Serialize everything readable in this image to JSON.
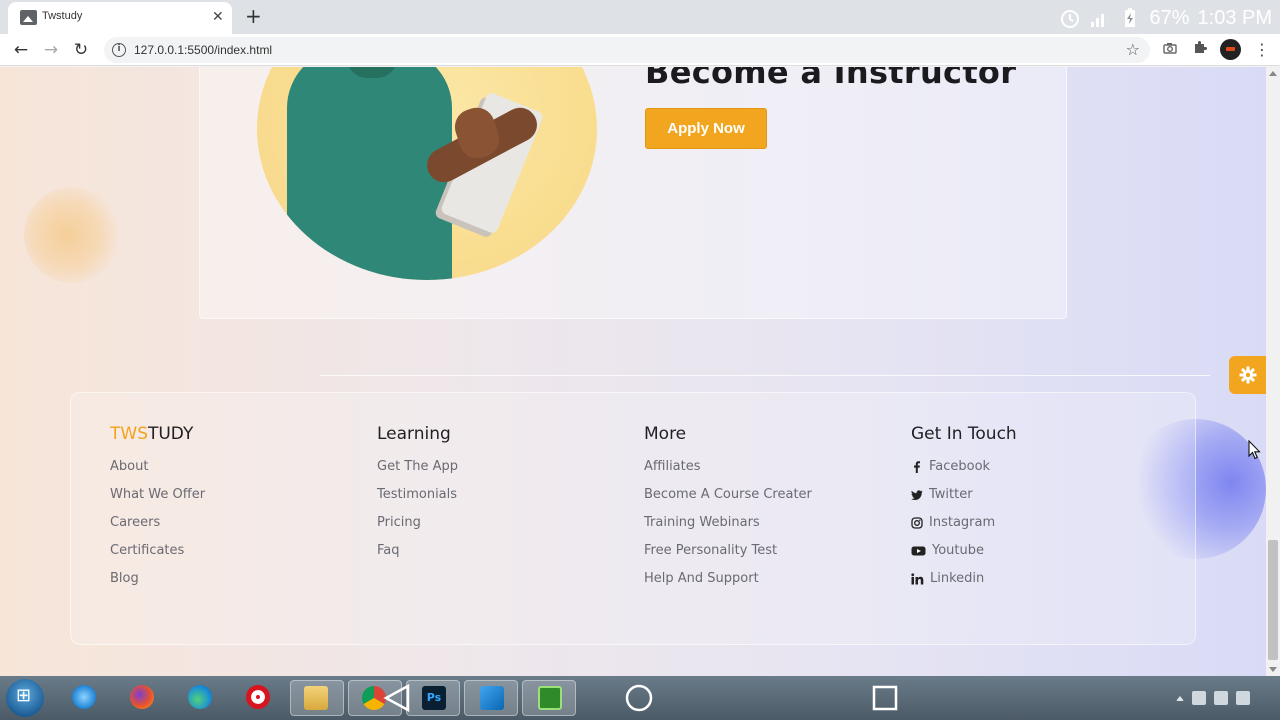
{
  "browser": {
    "tab_title": "Twstudy",
    "tab_close": "✕",
    "new_tab": "+",
    "url": "127.0.0.1:5500/index.html",
    "status_battery": "67%",
    "status_time": "1:03 PM"
  },
  "hero": {
    "title": "Become a Instructor",
    "apply_button": "Apply Now"
  },
  "footer": {
    "brand": {
      "accent": "TWS",
      "rest": "TUDY"
    },
    "columns": [
      {
        "title": "",
        "links": [
          "About",
          "What We Offer",
          "Careers",
          "Certificates",
          "Blog"
        ]
      },
      {
        "title": "Learning",
        "links": [
          "Get The App",
          "Testimonials",
          "Pricing",
          "Faq"
        ]
      },
      {
        "title": "More",
        "links": [
          "Affiliates",
          "Become A Course Creater",
          "Training Webinars",
          "Free Personality Test",
          "Help And Support"
        ]
      },
      {
        "title": "Get In Touch",
        "links": [
          "Facebook",
          "Twitter",
          "Instagram",
          "Youtube",
          "Linkedin"
        ]
      }
    ]
  },
  "colors": {
    "accent": "#f2a51e",
    "brand_accent": "#f0a51c",
    "text_dark": "#1f1f24",
    "link": "#6a6a72"
  },
  "icons": {
    "settings": "gear-icon",
    "social": [
      "facebook-icon",
      "twitter-icon",
      "instagram-icon",
      "youtube-icon",
      "linkedin-icon"
    ]
  }
}
